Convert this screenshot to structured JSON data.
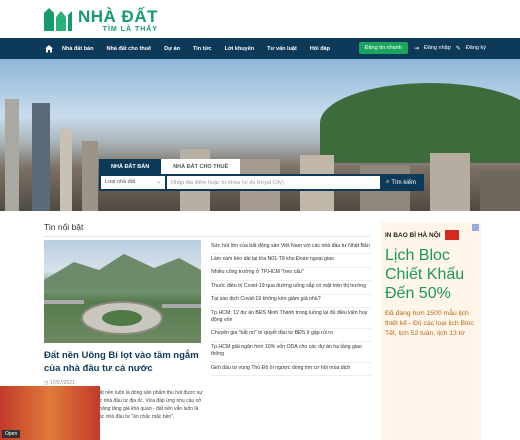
{
  "logo": {
    "main": "NHÀ ĐẤT",
    "sub": "TÌM LÀ THẤY"
  },
  "nav": {
    "items": [
      "Nhà đất bán",
      "Nhà đất cho thuê",
      "Dự án",
      "Tin tức",
      "Lời khuyên",
      "Tư vấn luật",
      "Hỏi đáp"
    ],
    "post_button": "Đăng tin nhanh",
    "login": "Đăng nhập",
    "register": "Đăng ký"
  },
  "search": {
    "tabs": [
      "NHÀ ĐẤT BÁN",
      "NHÀ ĐẤT CHO THUÊ"
    ],
    "type_select": "Loại nhà đất",
    "placeholder": "Nhập địa điểm hoặc từ khóa (ví dụ Royal City)",
    "button": "Tìm kiếm"
  },
  "section": {
    "title": "Tin nổi bật"
  },
  "featured": {
    "title": "Đất nền Uông Bí lọt vào tầm ngắm của nhà đầu tư cả nước",
    "date": "17/07/2021",
    "desc": "Không phải ngẫu nhiên đất nền luôn là dòng sản phẩm thu hút được sự quan tâm đặc biệt của các nhà đầu tư địa ốc. Vừa đáp ứng nhu cầu sở hữu lâu dài, vừa có tiềm năng tăng giá khả quan - đất nền vẫn luôn là lựa chọn hàng đầu của các nhà đầu tư \"ăn chắc mặc bền\"."
  },
  "news": [
    "Sức hút lớn của bất động sản Việt Nam với các nhà đầu tư Nhật Bản",
    "Làm xám kéo dài tại tòa N01-T8 khu Đoàn ngoại giao",
    "Nhiều công trường ở TP.HCM \"treo cẩu\"",
    "Thuốc điều trị Covid-19 qua đường uống sắp có mặt trên thị trường",
    "Tại sao dịch Covid-19 không kéo giảm giá nhà?",
    "Tp.HCM: 12 dự án BĐS Ninh Thành trong luồng lại đủ điều kiện huy động vốn",
    "Chuyên gia \"bắt mí\" bí quyết đầu tư BĐS ít gặp rủi ro",
    "Tp.HCM giải ngân hơn 10% vốn ODA cho các dự án hạ tầng giao thông",
    "Giới đầu tư vùng Thủ Đô ồi ngược dòng tìm cơ hội mùa dịch"
  ],
  "ad": {
    "header": "IN BAO BÌ HÀ NỘI",
    "title": "Lịch Bloc Chiết Khấu Đến 50%",
    "body": "Đã đang hơn 1500 mẫu lịch thiết kế - Đủ các loại lịch Bloc Tết, lịch 52 tuần, lịch 13 tờ",
    "open": "Open"
  }
}
